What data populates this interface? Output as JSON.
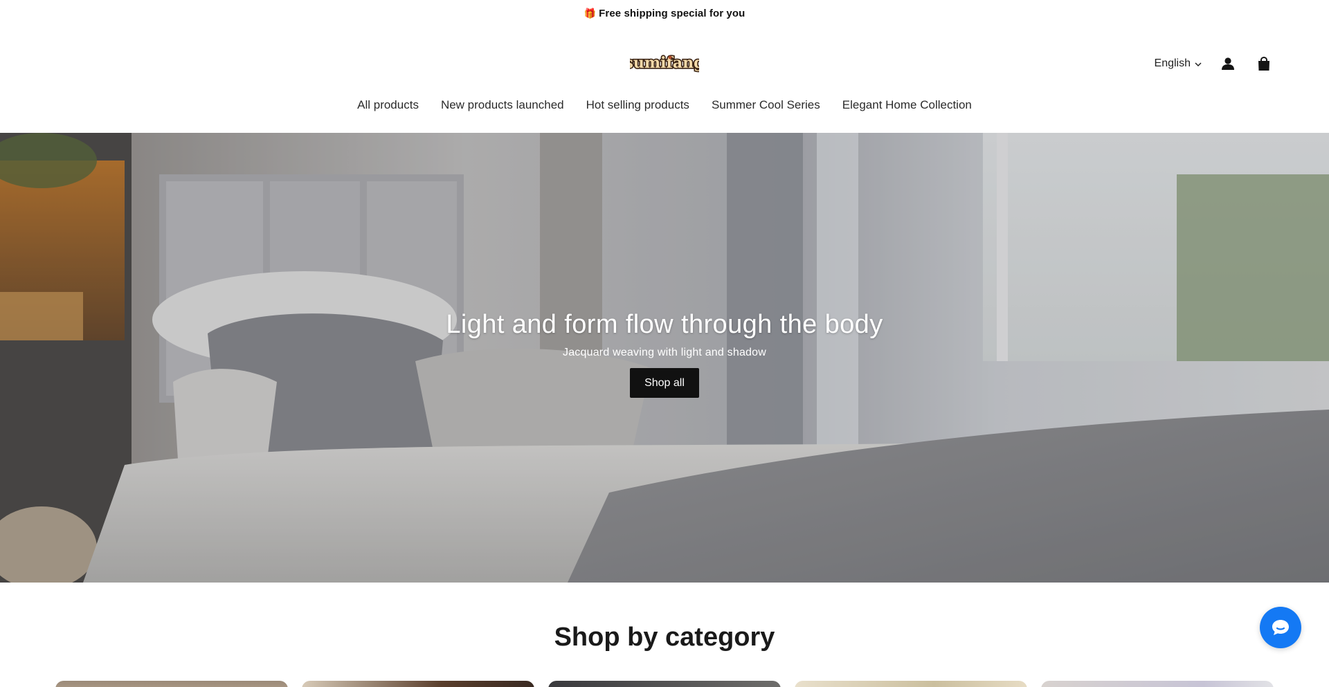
{
  "announcement": {
    "icon": "gift-icon",
    "text": "Free shipping special for you"
  },
  "header": {
    "logo_text": "sumifang",
    "language": "English",
    "icons": {
      "account": "user-icon",
      "cart": "shopping-bag-icon",
      "language_dropdown": "chevron-down-icon"
    }
  },
  "nav": {
    "items": [
      {
        "label": "All products"
      },
      {
        "label": "New products launched"
      },
      {
        "label": "Hot selling products"
      },
      {
        "label": "Summer Cool Series"
      },
      {
        "label": "Elegant Home Collection"
      }
    ]
  },
  "hero": {
    "title": "Light and form flow through the body",
    "subtitle": "Jacquard weaving with light and shadow",
    "button_label": "Shop all"
  },
  "categories": {
    "title": "Shop by category",
    "cards": [
      {
        "name": "category-card-1"
      },
      {
        "name": "category-card-2"
      },
      {
        "name": "category-card-3"
      },
      {
        "name": "category-card-4"
      },
      {
        "name": "category-card-5"
      }
    ]
  },
  "chat": {
    "icon": "chat-bubble-icon"
  },
  "colors": {
    "accent_chat": "#1479f4",
    "button_bg": "#111111",
    "text": "#121212"
  }
}
